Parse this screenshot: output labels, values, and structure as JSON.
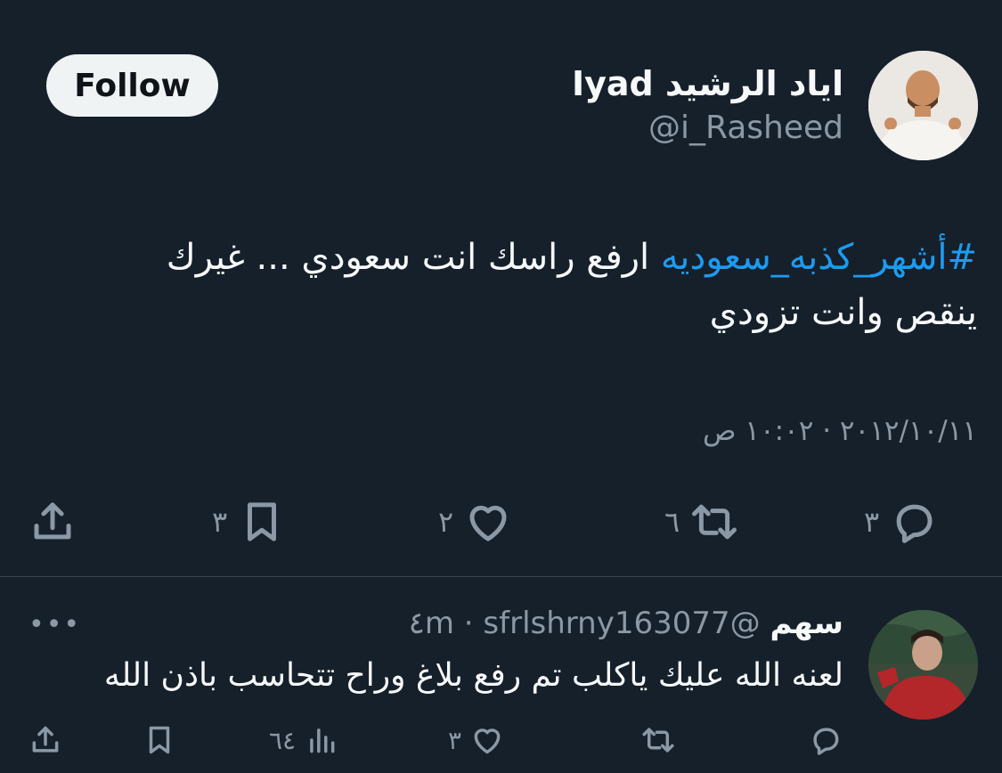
{
  "tweet": {
    "author_name": "اياد الرشيد Iyad",
    "author_handle": "@i_Rasheed",
    "follow_label": "Follow",
    "hashtag": "#أشهر_كذبه_سعوديه",
    "text": " ارفع راسك انت سعودي ... غيرك ينقص وانت تزودي",
    "timestamp": "٢٠١٢/١٠/١١ · ١٠:٠٢ ص",
    "actions": {
      "replies": "٣",
      "retweets": "٦",
      "likes": "٢",
      "bookmarks": "٣"
    }
  },
  "reply": {
    "author_name": "سهم",
    "meta": "@sfrlshrny163077 · ٤m",
    "more_label": "•••",
    "text": "لعنه الله عليك ياكلب تم رفع بلاغ وراح تتحاسب باذن الله",
    "actions": {
      "likes": "٣",
      "views": "٦٤"
    }
  },
  "colors": {
    "background": "#15202b",
    "accent": "#1d9bf0",
    "secondary_text": "#8b98a5",
    "divider": "#38444d"
  },
  "icons": [
    "reply-icon",
    "retweet-icon",
    "like-icon",
    "bookmark-icon",
    "share-icon",
    "views-icon",
    "more-icon"
  ]
}
